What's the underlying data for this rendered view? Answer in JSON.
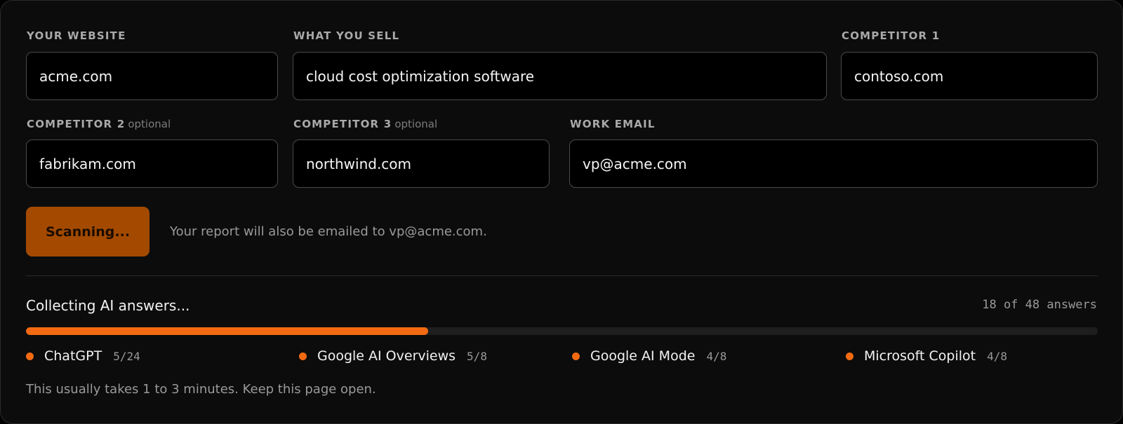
{
  "fields": {
    "website": {
      "label": "YOUR WEBSITE",
      "value": "acme.com"
    },
    "what_you_sell": {
      "label": "WHAT YOU SELL",
      "value": "cloud cost optimization software"
    },
    "competitor1": {
      "label": "COMPETITOR 1",
      "value": "contoso.com"
    },
    "competitor2": {
      "label": "COMPETITOR 2",
      "optional": "optional",
      "value": "fabrikam.com"
    },
    "competitor3": {
      "label": "COMPETITOR 3",
      "optional": "optional",
      "value": "northwind.com"
    },
    "work_email": {
      "label": "WORK EMAIL",
      "value": "vp@acme.com"
    }
  },
  "actions": {
    "scan_button_label": "Scanning...",
    "email_note": "Your report will also be emailed to vp@acme.com."
  },
  "progress": {
    "status_text": "Collecting AI answers...",
    "count_text": "18 of 48 answers",
    "completed": 18,
    "total": 48,
    "engines": [
      {
        "name": "ChatGPT",
        "count": "5/24"
      },
      {
        "name": "Google AI Overviews",
        "count": "5/8"
      },
      {
        "name": "Google AI Mode",
        "count": "4/8"
      },
      {
        "name": "Microsoft Copilot",
        "count": "4/8"
      }
    ],
    "hint": "This usually takes 1 to 3 minutes. Keep this page open."
  },
  "colors": {
    "accent": "#f36a12",
    "button_bg": "#a34a00",
    "card_bg": "#0c0c0c"
  }
}
